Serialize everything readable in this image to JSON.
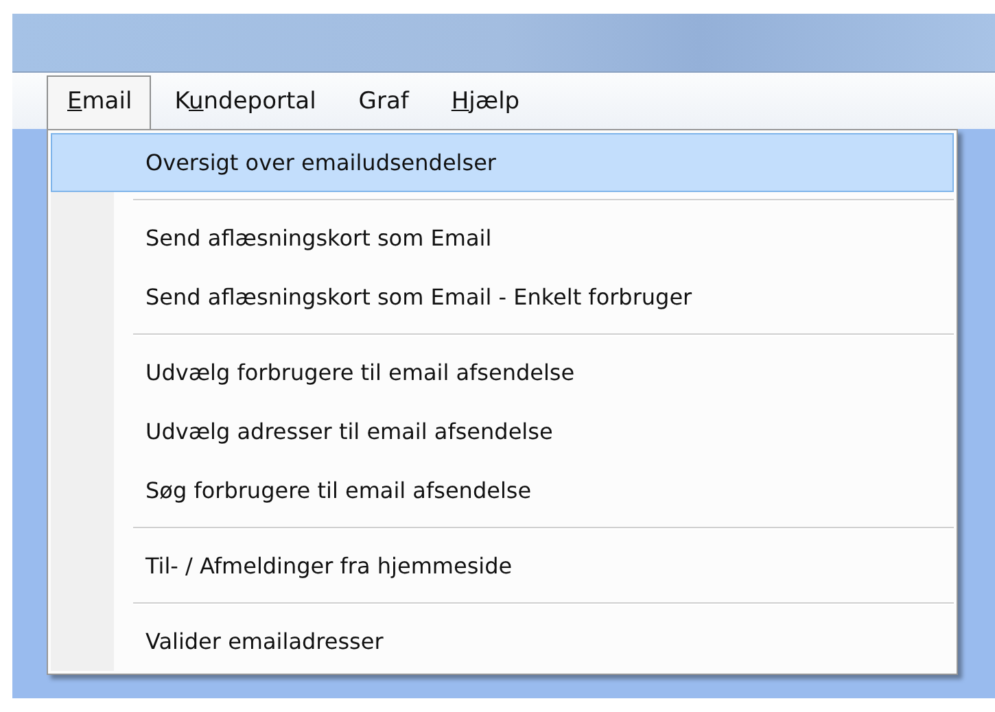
{
  "menu_bar": [
    {
      "access_key": "E",
      "label_rest": "mail",
      "selected": true
    },
    {
      "label_start": "K",
      "access_key": "u",
      "label_rest": "ndeportal",
      "selected": false
    },
    {
      "label_start": "Graf",
      "selected": false
    },
    {
      "access_key": "H",
      "label_rest": "jælp",
      "selected": false
    }
  ],
  "dropdown": [
    {
      "kind": "item",
      "label": "Oversigt over emailudsendelser",
      "selected": true
    },
    {
      "kind": "separator"
    },
    {
      "kind": "item",
      "label": "Send aflæsningskort som Email",
      "selected": false
    },
    {
      "kind": "item",
      "label": "Send aflæsningskort som Email - Enkelt forbruger",
      "selected": false
    },
    {
      "kind": "separator"
    },
    {
      "kind": "item",
      "label": "Udvælg forbrugere til email afsendelse",
      "selected": false
    },
    {
      "kind": "item",
      "label": "Udvælg adresser til email afsendelse",
      "selected": false
    },
    {
      "kind": "item",
      "label": "Søg forbrugere til email afsendelse",
      "selected": false
    },
    {
      "kind": "separator"
    },
    {
      "kind": "item",
      "label": "Til- / Afmeldinger fra hjemmeside",
      "selected": false
    },
    {
      "kind": "separator"
    },
    {
      "kind": "item",
      "label": "Valider emailadresser",
      "selected": false
    }
  ]
}
